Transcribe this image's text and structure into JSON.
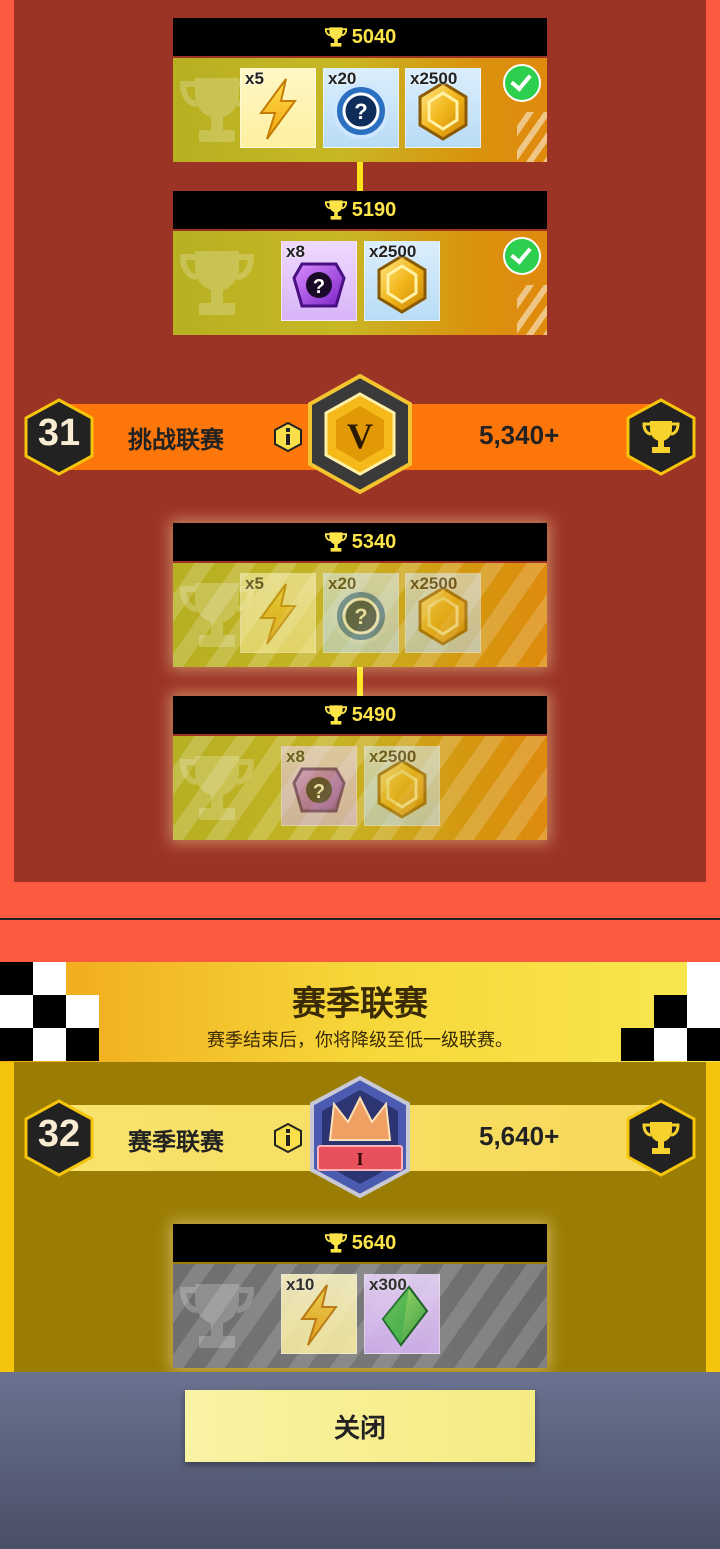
{
  "leagues": [
    {
      "rank": "31",
      "name": "挑战联赛",
      "trophies_required": "5,340+",
      "badge_letter": "V",
      "bar_color": "#fd7609"
    },
    {
      "rank": "32",
      "name": "赛季联赛",
      "trophies_required": "5,640+",
      "badge_letter": "I",
      "bar_color": "#f9e36c"
    }
  ],
  "tiers": [
    {
      "trophies": "5040",
      "claimed": true,
      "items": [
        {
          "type": "energy-bolt",
          "qty": "x5"
        },
        {
          "type": "mystery-token",
          "qty": "x20"
        },
        {
          "type": "gold-coin",
          "qty": "x2500"
        }
      ]
    },
    {
      "trophies": "5190",
      "claimed": true,
      "items": [
        {
          "type": "mystery-gem-box",
          "qty": "x8"
        },
        {
          "type": "gold-coin",
          "qty": "x2500"
        }
      ]
    },
    {
      "trophies": "5340",
      "claimed": false,
      "items": [
        {
          "type": "energy-bolt",
          "qty": "x5"
        },
        {
          "type": "mystery-token",
          "qty": "x20"
        },
        {
          "type": "gold-coin",
          "qty": "x2500"
        }
      ]
    },
    {
      "trophies": "5490",
      "claimed": false,
      "items": [
        {
          "type": "mystery-gem-box",
          "qty": "x8"
        },
        {
          "type": "gold-coin",
          "qty": "x2500"
        }
      ]
    },
    {
      "trophies": "5640",
      "claimed": false,
      "items": [
        {
          "type": "energy-bolt",
          "qty": "x10"
        },
        {
          "type": "green-gem",
          "qty": "x300"
        }
      ]
    }
  ],
  "season_header": {
    "title": "赛季联赛",
    "subtitle": "赛季结束后，你将降级至低一级联赛。"
  },
  "close_button": "关闭"
}
